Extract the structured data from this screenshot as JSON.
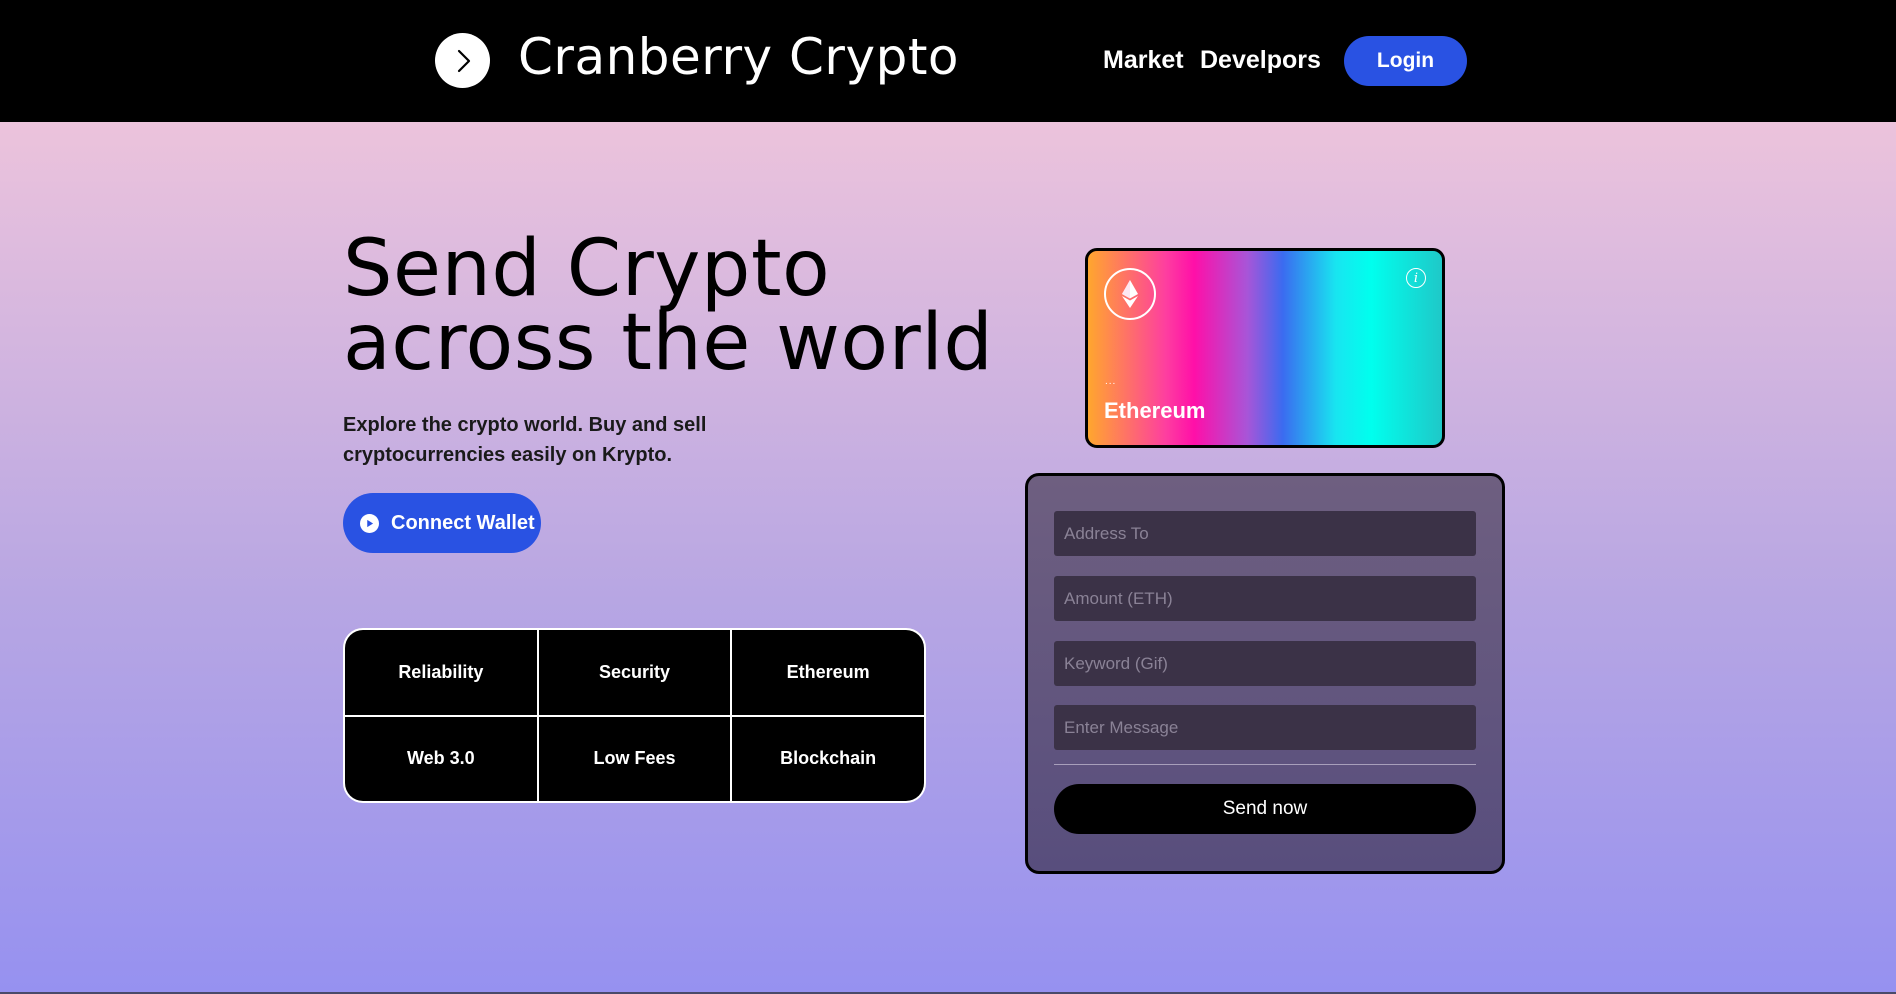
{
  "nav": {
    "brand": "Cranberry Crypto",
    "links": [
      "Market",
      "Develpors"
    ],
    "login_label": "Login"
  },
  "hero": {
    "headline_line1": "Send Crypto",
    "headline_line2": "across the world",
    "subtext": "Explore the crypto world. Buy and sell cryptocurrencies easily on Krypto.",
    "connect_label": "Connect Wallet",
    "features": [
      "Reliability",
      "Security",
      "Ethereum",
      "Web 3.0",
      "Low Fees",
      "Blockchain"
    ]
  },
  "card": {
    "dots": "...",
    "name": "Ethereum",
    "logo_icon": "ethereum-icon",
    "info_icon": "info-icon"
  },
  "form": {
    "address_placeholder": "Address To",
    "amount_placeholder": "Amount (ETH)",
    "keyword_placeholder": "Keyword (Gif)",
    "message_placeholder": "Enter Message",
    "send_label": "Send now"
  },
  "colors": {
    "accent": "#2952e3",
    "nav_bg": "#000000",
    "gradient_top": "#ecc3dc",
    "gradient_bottom": "#9691f0"
  }
}
